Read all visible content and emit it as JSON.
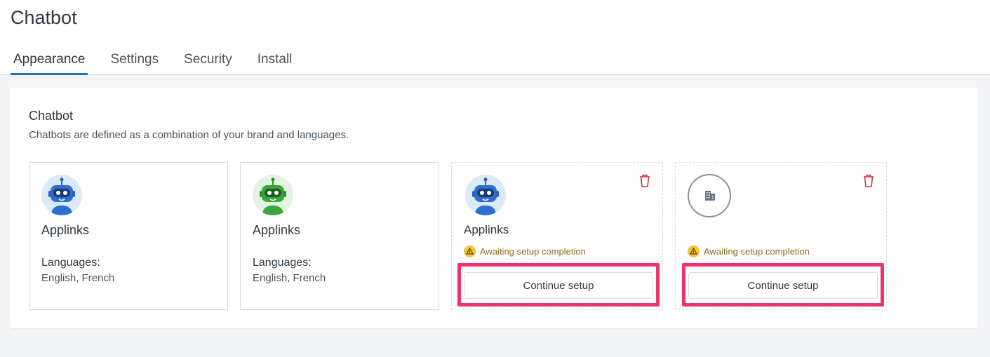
{
  "header": {
    "title": "Chatbot",
    "tabs": [
      {
        "label": "Appearance",
        "active": true
      },
      {
        "label": "Settings",
        "active": false
      },
      {
        "label": "Security",
        "active": false
      },
      {
        "label": "Install",
        "active": false
      }
    ]
  },
  "panel": {
    "title": "Chatbot",
    "subtitle": "Chatbots are defined as a combination of your brand and languages."
  },
  "cards": [
    {
      "name": "Applinks",
      "languages_label": "Languages:",
      "languages": "English, French",
      "avatar": "blue-robot-icon"
    },
    {
      "name": "Applinks",
      "languages_label": "Languages:",
      "languages": "English, French",
      "avatar": "green-robot-icon"
    },
    {
      "name": "Applinks",
      "status": "Awaiting setup completion",
      "button": "Continue setup",
      "avatar": "blue-robot-icon"
    },
    {
      "status": "Awaiting setup completion",
      "button": "Continue setup",
      "avatar": "building-icon"
    }
  ],
  "colors": {
    "accent": "#1f73b7",
    "highlight": "#f0336b",
    "danger": "#cc3340",
    "warning": "#f5c342"
  }
}
